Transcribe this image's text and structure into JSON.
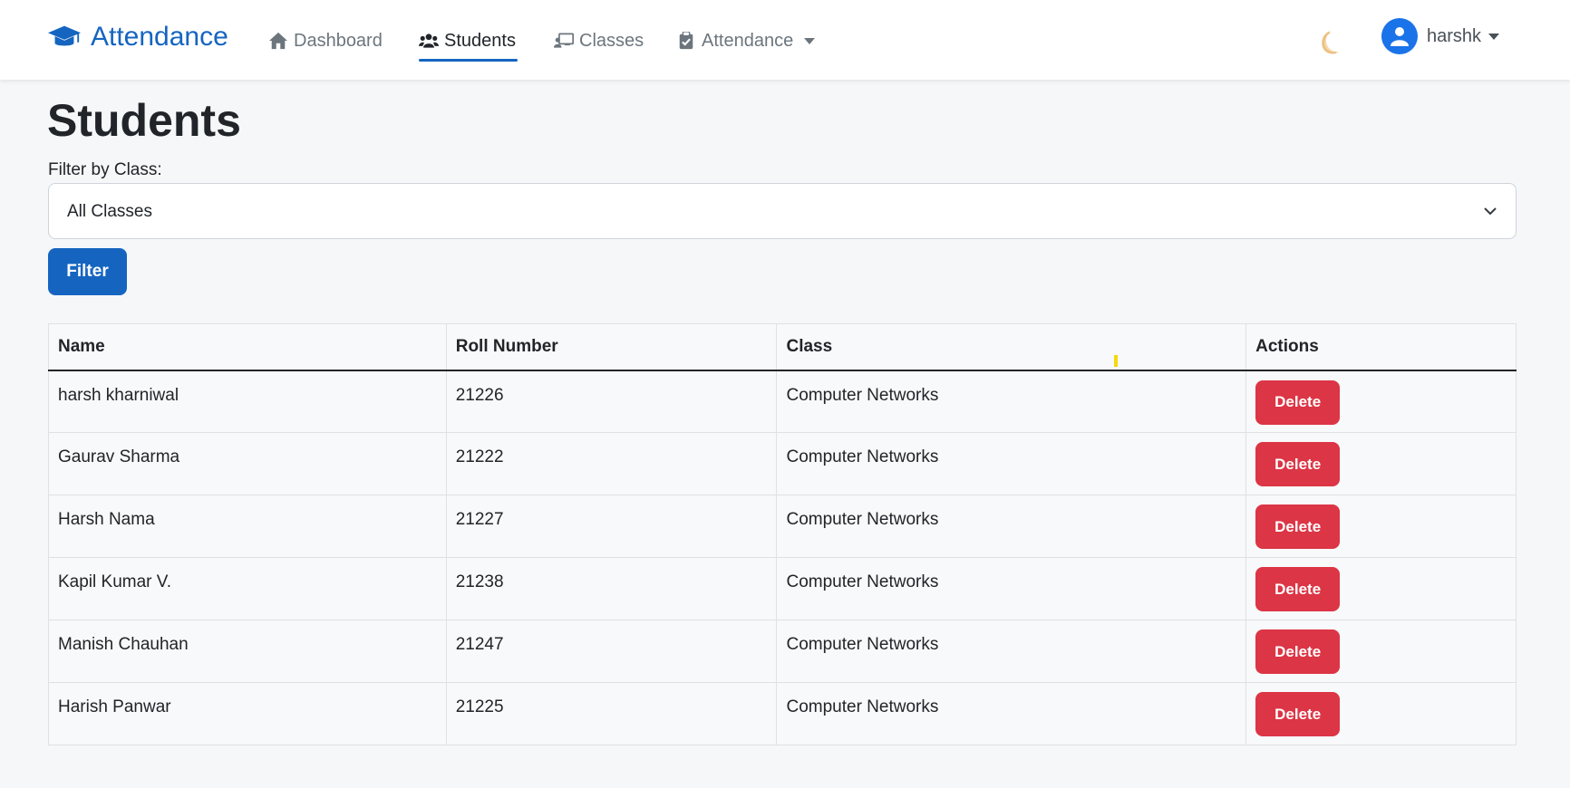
{
  "colors": {
    "brand": "#1565c0",
    "danger": "#dc3545",
    "nav_text": "#6c757d",
    "background": "#f6f7f9"
  },
  "navbar": {
    "brand_icon": "graduation-cap-icon",
    "brand": "Attendance",
    "links": [
      {
        "label": "Dashboard",
        "icon": "home-icon",
        "active": false
      },
      {
        "label": "Students",
        "icon": "users-icon",
        "active": true
      },
      {
        "label": "Classes",
        "icon": "chalkboard-teacher-icon",
        "active": false
      },
      {
        "label": "Attendance",
        "icon": "clipboard-check-icon",
        "active": false,
        "dropdown": true
      }
    ],
    "theme_icon": "moon-icon",
    "user": {
      "name": "harshk",
      "icon": "user-icon"
    }
  },
  "main": {
    "title": "Students",
    "filter_label": "Filter by Class:",
    "select_value": "All Classes",
    "filter_button": "Filter"
  },
  "table": {
    "headers": [
      "Name",
      "Roll Number",
      "Class",
      "Actions"
    ],
    "rows": [
      {
        "name": "harsh kharniwal",
        "roll": "21226",
        "class": "Computer Networks",
        "action": "Delete"
      },
      {
        "name": "Gaurav Sharma",
        "roll": "21222",
        "class": "Computer Networks",
        "action": "Delete"
      },
      {
        "name": "Harsh Nama",
        "roll": "21227",
        "class": "Computer Networks",
        "action": "Delete"
      },
      {
        "name": "Kapil Kumar V.",
        "roll": "21238",
        "class": "Computer Networks",
        "action": "Delete"
      },
      {
        "name": "Manish Chauhan",
        "roll": "21247",
        "class": "Computer Networks",
        "action": "Delete"
      },
      {
        "name": "Harish Panwar",
        "roll": "21225",
        "class": "Computer Networks",
        "action": "Delete"
      }
    ]
  }
}
